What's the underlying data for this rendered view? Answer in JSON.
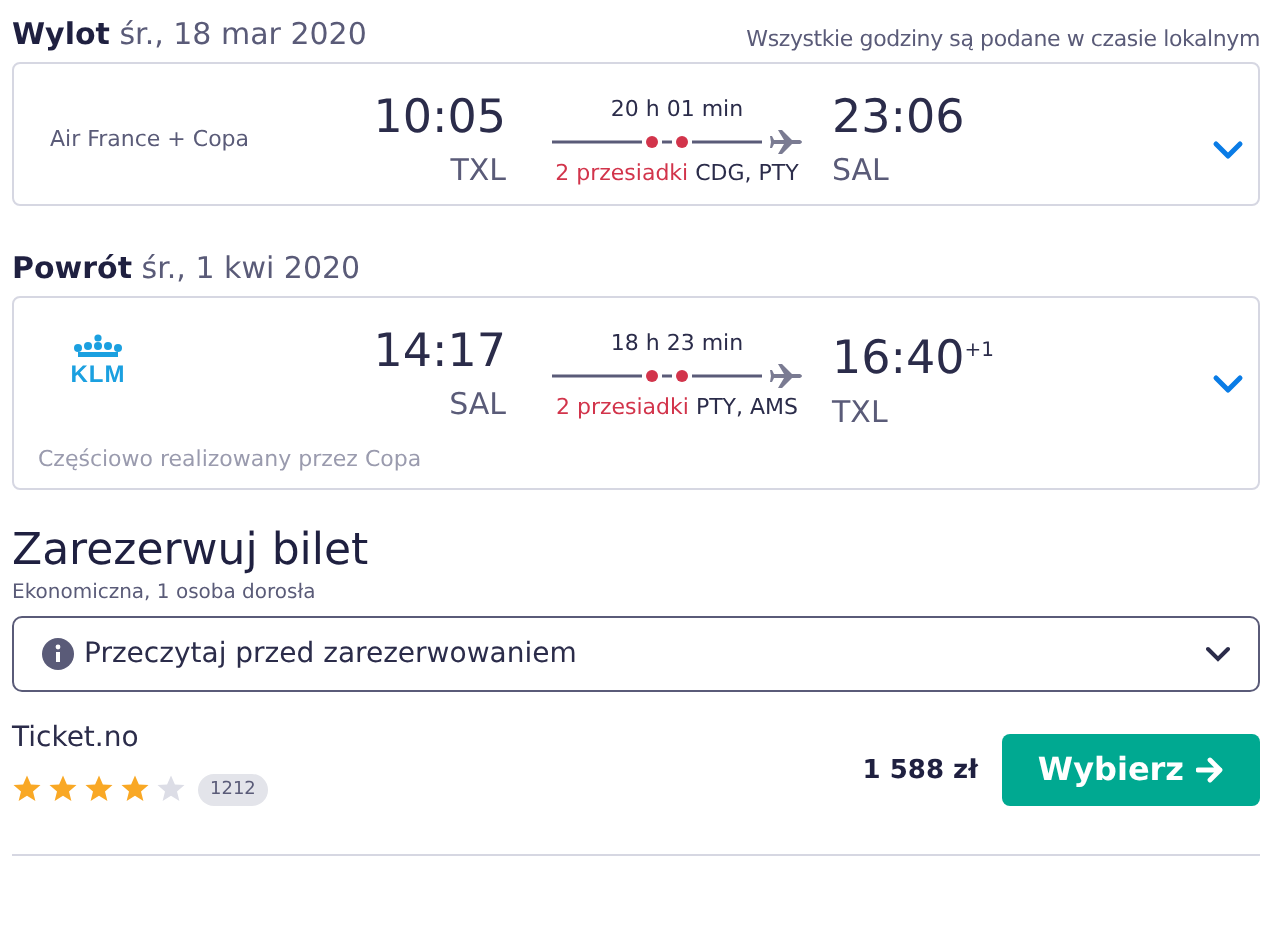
{
  "timezone_note": "Wszystkie godziny są podane w czasie lokalnym",
  "flights": [
    {
      "label": "Wylot",
      "date": "śr., 18 mar 2020",
      "airline": {
        "kind": "text",
        "name": "Air France + Copa"
      },
      "dep_time": "10:05",
      "dep_airport": "TXL",
      "duration": "20 h 01 min",
      "stops": "2 przesiadki",
      "via": "CDG, PTY",
      "arr_time": "23:06",
      "arr_airport": "SAL",
      "expanded": false
    },
    {
      "label": "Powrót",
      "date": "śr., 1 kwi 2020",
      "airline": {
        "kind": "logo",
        "name": "KLM"
      },
      "dep_time": "14:17",
      "dep_airport": "SAL",
      "duration": "18 h 23 min",
      "stops": "2 przesiadki",
      "via": "PTY, AMS",
      "arr_time": "16:40$^{+1}$",
      "arr_airport": "TXL",
      "note": "Częściowo realizowany przez Copa",
      "expanded": false
    }
  ],
  "booking": {
    "title": "Zarezerwuj bilet",
    "subtitle": "Ekonomiczna, 1 osoba dorosła",
    "notice": {
      "label": "Przeczytaj przed zarezerwowaniem",
      "expanded": false
    }
  },
  "offer": {
    "provider": "Ticket.no",
    "stars": 4,
    "reviews": "1212",
    "price": "1 588 zł",
    "button": "Wybierz"
  }
}
